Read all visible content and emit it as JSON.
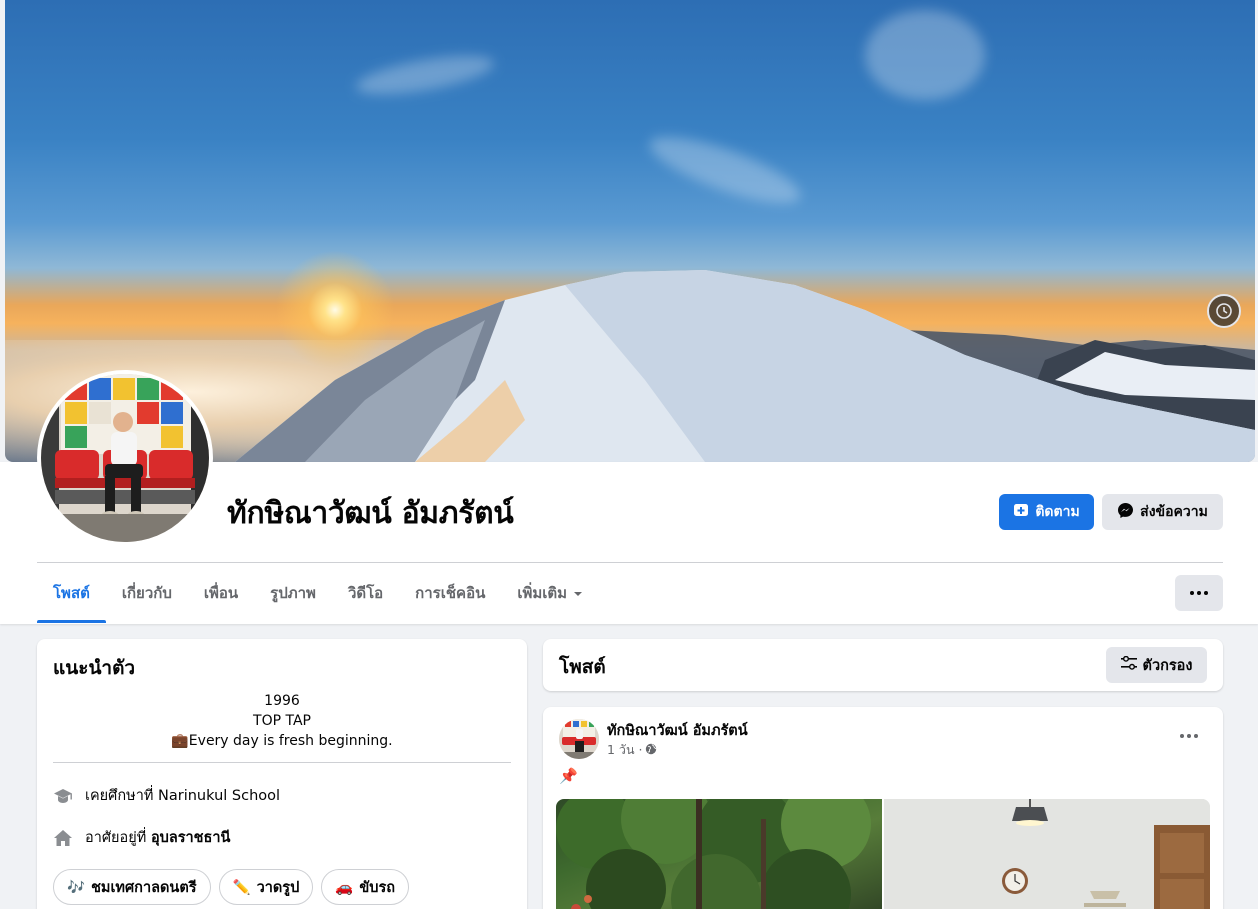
{
  "profile": {
    "name": "ทักษิณาวัฒน์ อัมภรัตน์"
  },
  "actions": {
    "follow_label": "ติดตาม",
    "message_label": "ส่งข้อความ"
  },
  "tabs": [
    {
      "label": "โพสต์",
      "active": true
    },
    {
      "label": "เกี่ยวกับ",
      "active": false
    },
    {
      "label": "เพื่อน",
      "active": false
    },
    {
      "label": "รูปภาพ",
      "active": false
    },
    {
      "label": "วิดีโอ",
      "active": false
    },
    {
      "label": "การเช็คอิน",
      "active": false
    },
    {
      "label": "เพิ่มเติม",
      "active": false
    }
  ],
  "intro": {
    "title": "แนะนำตัว",
    "bio_lines": [
      "1996",
      "TOP TAP",
      "💼Every day is fresh beginning."
    ],
    "education_prefix": "เคยศึกษาที่ ",
    "education_value": "Narinukul School",
    "lives_prefix": "อาศัยอยู่ที่ ",
    "lives_value": "อุบลราชธานี",
    "hobbies": [
      {
        "icon": "music-notes-icon",
        "emoji": "🎶",
        "label": "ชมเทศกาลดนตรี"
      },
      {
        "icon": "pencil-icon",
        "emoji": "✏️",
        "label": "วาดรูป"
      },
      {
        "icon": "car-icon",
        "emoji": "🚗",
        "label": "ขับรถ"
      }
    ]
  },
  "posts_header": {
    "title": "โพสต์",
    "filter_label": "ตัวกรอง"
  },
  "post": {
    "author": "ทักษิณาวัฒน์ อัมภรัตน์",
    "time": "1 วัน · ",
    "text": "📌"
  },
  "colors": {
    "accent": "#1b74e4",
    "button_grey": "#e4e6eb",
    "page_bg": "#f0f2f5"
  }
}
